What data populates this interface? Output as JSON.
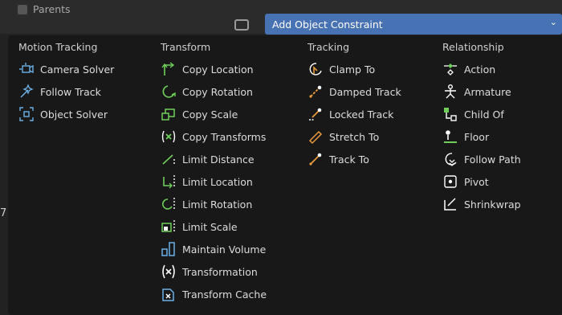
{
  "background": {
    "parents_label": "Parents",
    "left_number": "7"
  },
  "header": {
    "title": "Add Object Constraint",
    "chevron": "⌄"
  },
  "colors": {
    "accent": "#4772b3",
    "menu_bg": "#181818",
    "icon_blue": "#6cb0e6",
    "icon_green": "#6fcf5a",
    "icon_orange": "#e89a3c"
  },
  "menu": {
    "motion_tracking": {
      "heading": "Motion Tracking",
      "items": [
        {
          "label": "Camera Solver",
          "icon": "camera-solver-icon"
        },
        {
          "label": "Follow Track",
          "icon": "follow-track-icon"
        },
        {
          "label": "Object Solver",
          "icon": "object-solver-icon"
        }
      ]
    },
    "transform": {
      "heading": "Transform",
      "items": [
        {
          "label": "Copy Location",
          "icon": "copy-location-icon"
        },
        {
          "label": "Copy Rotation",
          "icon": "copy-rotation-icon"
        },
        {
          "label": "Copy Scale",
          "icon": "copy-scale-icon"
        },
        {
          "label": "Copy Transforms",
          "icon": "copy-transforms-icon"
        },
        {
          "label": "Limit Distance",
          "icon": "limit-distance-icon"
        },
        {
          "label": "Limit Location",
          "icon": "limit-location-icon"
        },
        {
          "label": "Limit Rotation",
          "icon": "limit-rotation-icon"
        },
        {
          "label": "Limit Scale",
          "icon": "limit-scale-icon"
        },
        {
          "label": "Maintain Volume",
          "icon": "maintain-volume-icon"
        },
        {
          "label": "Transformation",
          "icon": "transformation-icon"
        },
        {
          "label": "Transform Cache",
          "icon": "transform-cache-icon"
        }
      ]
    },
    "tracking": {
      "heading": "Tracking",
      "items": [
        {
          "label": "Clamp To",
          "icon": "clamp-to-icon"
        },
        {
          "label": "Damped Track",
          "icon": "damped-track-icon"
        },
        {
          "label": "Locked Track",
          "icon": "locked-track-icon"
        },
        {
          "label": "Stretch To",
          "icon": "stretch-to-icon"
        },
        {
          "label": "Track To",
          "icon": "track-to-icon"
        }
      ]
    },
    "relationship": {
      "heading": "Relationship",
      "items": [
        {
          "label": "Action",
          "icon": "action-icon"
        },
        {
          "label": "Armature",
          "icon": "armature-icon"
        },
        {
          "label": "Child Of",
          "icon": "child-of-icon"
        },
        {
          "label": "Floor",
          "icon": "floor-icon"
        },
        {
          "label": "Follow Path",
          "icon": "follow-path-icon"
        },
        {
          "label": "Pivot",
          "icon": "pivot-icon"
        },
        {
          "label": "Shrinkwrap",
          "icon": "shrinkwrap-icon"
        }
      ]
    }
  }
}
